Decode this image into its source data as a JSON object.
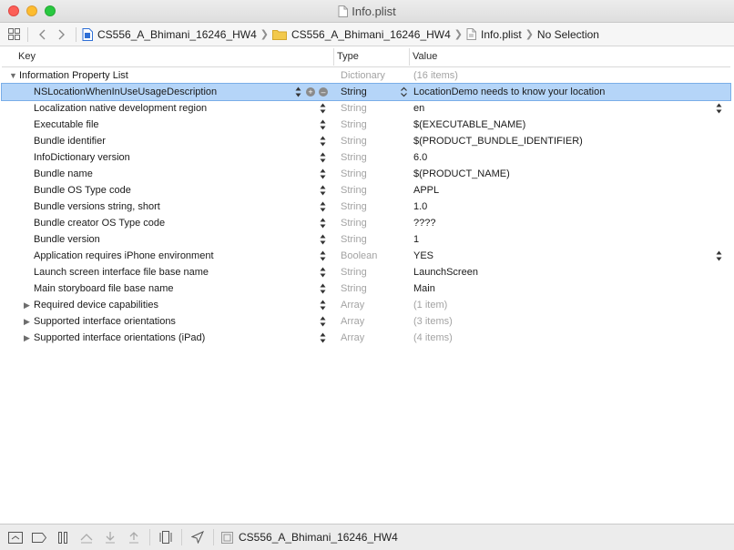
{
  "window": {
    "title": "Info.plist"
  },
  "jumpbar": {
    "crumbs": [
      {
        "label": "CS556_A_Bhimani_16246_HW4",
        "icon": "xcode-project-icon"
      },
      {
        "label": "CS556_A_Bhimani_16246_HW4",
        "icon": "folder-icon"
      },
      {
        "label": "Info.plist",
        "icon": "plist-file-icon"
      },
      {
        "label": "No Selection",
        "icon": ""
      }
    ]
  },
  "table": {
    "headers": {
      "key": "Key",
      "type": "Type",
      "value": "Value"
    },
    "rows": [
      {
        "key": "Information Property List",
        "type": "Dictionary",
        "value": "(16 items)",
        "level": 0,
        "disclosure": "expanded",
        "dim_value": true
      },
      {
        "key": "NSLocationWhenInUseUsageDescription",
        "type": "String",
        "value": "LocationDemo needs to know your location",
        "level": 1,
        "selected": true
      },
      {
        "key": "Localization native development region",
        "type": "String",
        "value": "en",
        "level": 1,
        "value_popup": true
      },
      {
        "key": "Executable file",
        "type": "String",
        "value": "$(EXECUTABLE_NAME)",
        "level": 1
      },
      {
        "key": "Bundle identifier",
        "type": "String",
        "value": "$(PRODUCT_BUNDLE_IDENTIFIER)",
        "level": 1
      },
      {
        "key": "InfoDictionary version",
        "type": "String",
        "value": "6.0",
        "level": 1
      },
      {
        "key": "Bundle name",
        "type": "String",
        "value": "$(PRODUCT_NAME)",
        "level": 1
      },
      {
        "key": "Bundle OS Type code",
        "type": "String",
        "value": "APPL",
        "level": 1
      },
      {
        "key": "Bundle versions string, short",
        "type": "String",
        "value": "1.0",
        "level": 1
      },
      {
        "key": "Bundle creator OS Type code",
        "type": "String",
        "value": "????",
        "level": 1
      },
      {
        "key": "Bundle version",
        "type": "String",
        "value": "1",
        "level": 1
      },
      {
        "key": "Application requires iPhone environment",
        "type": "Boolean",
        "value": "YES",
        "level": 1,
        "value_popup": true
      },
      {
        "key": "Launch screen interface file base name",
        "type": "String",
        "value": "LaunchScreen",
        "level": 1
      },
      {
        "key": "Main storyboard file base name",
        "type": "String",
        "value": "Main",
        "level": 1
      },
      {
        "key": "Required device capabilities",
        "type": "Array",
        "value": "(1 item)",
        "level": 1,
        "disclosure": "collapsed",
        "dim_value": true
      },
      {
        "key": "Supported interface orientations",
        "type": "Array",
        "value": "(3 items)",
        "level": 1,
        "disclosure": "collapsed",
        "dim_value": true
      },
      {
        "key": "Supported interface orientations (iPad)",
        "type": "Array",
        "value": "(4 items)",
        "level": 1,
        "disclosure": "collapsed",
        "dim_value": true
      }
    ]
  },
  "debugbar": {
    "target": "CS556_A_Bhimani_16246_HW4"
  },
  "colors": {
    "selection": "#b5d5f8",
    "dim_text": "#a3a3a3",
    "folder": "#f2c94c",
    "project": "#2f6fd6"
  }
}
